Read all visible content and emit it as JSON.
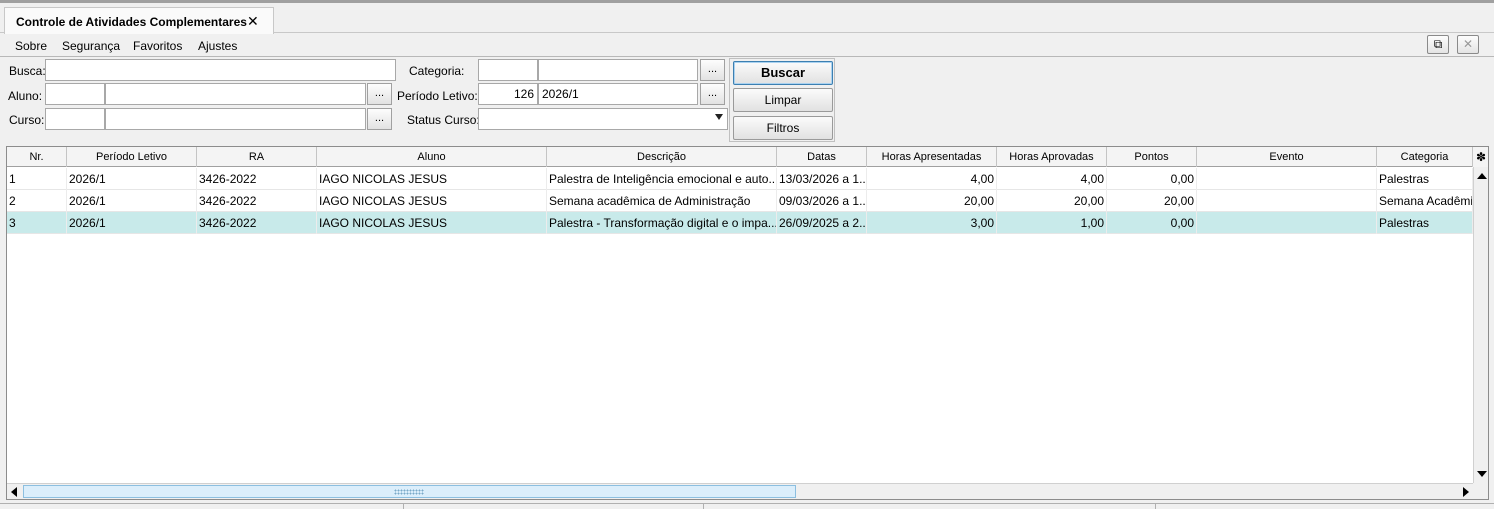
{
  "window": {
    "tab_title": "Controle de Atividades Complementares",
    "tab_close": "✕"
  },
  "menu": {
    "items": [
      "Sobre",
      "Segurança",
      "Favoritos",
      "Ajustes"
    ]
  },
  "window_controls": {
    "popout": "⧉",
    "close": "✕"
  },
  "filters": {
    "busca_label": "Busca:",
    "busca_value": "",
    "aluno_label": "Aluno:",
    "aluno_code": "",
    "aluno_name": "",
    "curso_label": "Curso:",
    "curso_code": "",
    "curso_name": "",
    "categoria_label": "Categoria:",
    "categoria_code": "",
    "categoria_name": "",
    "periodo_label": "Período Letivo:",
    "periodo_code": "126",
    "periodo_name": "2026/1",
    "status_label": "Status Curso:",
    "status_value": "",
    "lookup_button": "..."
  },
  "buttons": {
    "buscar": "Buscar",
    "limpar": "Limpar",
    "filtros": "Filtros"
  },
  "grid": {
    "columns": [
      "Nr.",
      "Período Letivo",
      "RA",
      "Aluno",
      "Descrição",
      "Datas",
      "Horas Apresentadas",
      "Horas Aprovadas",
      "Pontos",
      "Evento",
      "Categoria"
    ],
    "rows": [
      {
        "nr": "1",
        "periodo": "2026/1",
        "ra": "3426-2022",
        "aluno": "IAGO NICOLAS JESUS",
        "descricao": "Palestra de Inteligência emocional e auto...",
        "datas": "13/03/2026 a 1...",
        "horas_apresentadas": "4,00",
        "horas_aprovadas": "4,00",
        "pontos": "0,00",
        "evento": "",
        "categoria": "Palestras"
      },
      {
        "nr": "2",
        "periodo": "2026/1",
        "ra": "3426-2022",
        "aluno": "IAGO NICOLAS JESUS",
        "descricao": "Semana acadêmica de Administração",
        "datas": "09/03/2026 a 1...",
        "horas_apresentadas": "20,00",
        "horas_aprovadas": "20,00",
        "pontos": "20,00",
        "evento": "",
        "categoria": "Semana Acadêmica"
      },
      {
        "nr": "3",
        "periodo": "2026/1",
        "ra": "3426-2022",
        "aluno": "IAGO NICOLAS JESUS",
        "descricao": "Palestra - Transformação digital e o impa...",
        "datas": "26/09/2025 a 2...",
        "horas_apresentadas": "3,00",
        "horas_aprovadas": "1,00",
        "pontos": "0,00",
        "evento": "",
        "categoria": "Palestras"
      }
    ],
    "selected_row": 3,
    "settings_icon": "✽"
  }
}
